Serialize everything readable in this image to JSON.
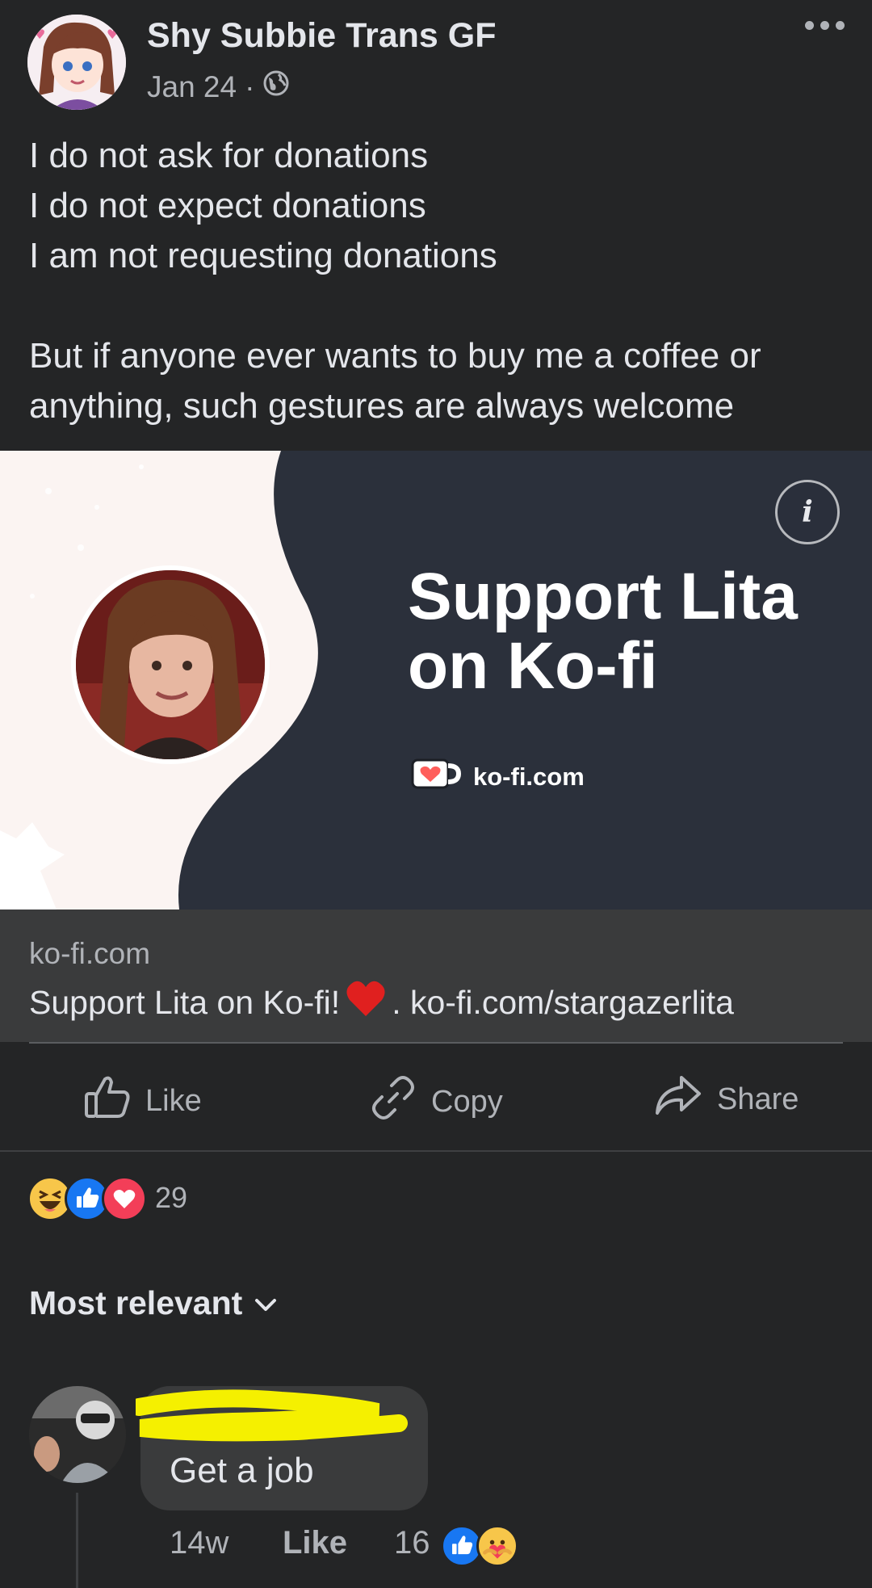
{
  "post": {
    "author": "Shy Subbie Trans GF",
    "date": "Jan 24",
    "separator": "·",
    "privacy_icon": "globe-icon",
    "text": "I do not ask for donations\nI do not expect donations\nI am not requesting donations\n\nBut if anyone ever wants to buy me a coffee or anything, such gestures are always welcome"
  },
  "banner": {
    "title_line1": "Support Lita",
    "title_line2": "on Ko-fi",
    "brand": "ko-fi.com",
    "info_glyph": "i"
  },
  "link_preview": {
    "domain": "ko-fi.com",
    "title_before": "Support Lita on Ko-fi!",
    "title_after": ". ko-fi.com/stargazerlita"
  },
  "actions": {
    "like": "Like",
    "copy": "Copy",
    "share": "Share"
  },
  "reactions": {
    "count": "29",
    "types": [
      "haha",
      "like",
      "love"
    ]
  },
  "sort": {
    "label": "Most relevant"
  },
  "comment": {
    "text": "Get a job",
    "time": "14w",
    "like": "Like",
    "reaction_count": "16",
    "reaction_types": [
      "like",
      "care"
    ]
  },
  "colors": {
    "background": "#242526",
    "text_primary": "#e4e6eb",
    "text_secondary": "#b0b3b8",
    "banner_dark": "#2b303b",
    "redaction": "#f5f000"
  }
}
